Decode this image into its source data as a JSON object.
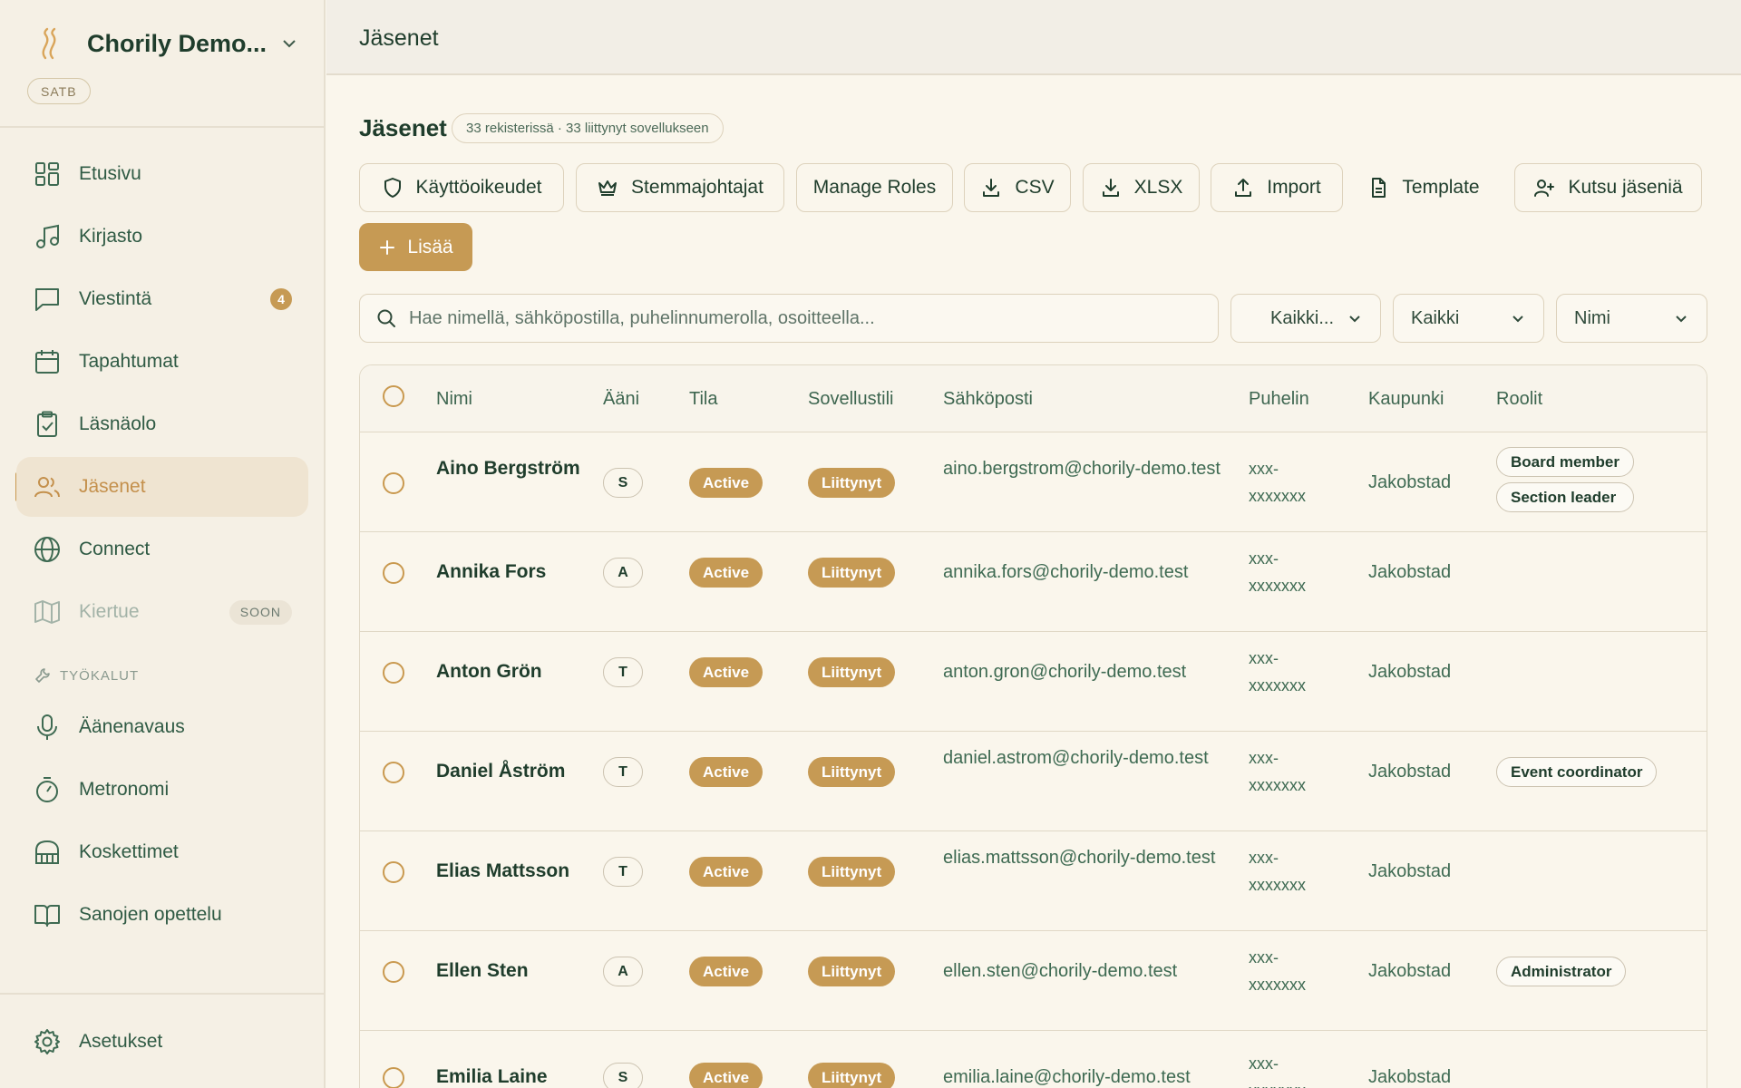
{
  "sidebar": {
    "org_name": "Chorily Demo...",
    "voice_type": "SATB",
    "nav": [
      {
        "label": "Etusivu",
        "icon": "grid-icon"
      },
      {
        "label": "Kirjasto",
        "icon": "music-note-icon"
      },
      {
        "label": "Viestintä",
        "icon": "chat-icon",
        "badge": "4"
      },
      {
        "label": "Tapahtumat",
        "icon": "calendar-icon"
      },
      {
        "label": "Läsnäolo",
        "icon": "clipboard-check-icon"
      },
      {
        "label": "Jäsenet",
        "icon": "users-icon",
        "active": true
      },
      {
        "label": "Connect",
        "icon": "globe-icon"
      },
      {
        "label": "Kiertue",
        "icon": "map-icon",
        "badge": "SOON",
        "disabled": true
      }
    ],
    "tools_label": "TYÖKALUT",
    "tools": [
      {
        "label": "Äänenavaus",
        "icon": "microphone-icon"
      },
      {
        "label": "Metronomi",
        "icon": "timer-icon"
      },
      {
        "label": "Koskettimet",
        "icon": "piano-icon"
      },
      {
        "label": "Sanojen opettelu",
        "icon": "book-open-icon"
      }
    ],
    "settings_label": "Asetukset"
  },
  "topbar": {
    "title": "Jäsenet"
  },
  "main": {
    "title": "Jäsenet",
    "count_summary": "33 rekisterissä · 33 liittynyt sovellukseen",
    "toolbar": {
      "permissions": "Käyttöoikeudet",
      "section_leaders": "Stemmajohtajat",
      "manage_roles": "Manage Roles",
      "csv": "CSV",
      "xlsx": "XLSX",
      "import": "Import",
      "template": "Template",
      "invite": "Kutsu jäseniä",
      "add": "Lisää"
    },
    "search_placeholder": "Hae nimellä, sähköpostilla, puhelinnumerolla, osoitteella...",
    "filters": {
      "voice": "Kaikki...",
      "status": "Kaikki",
      "sort": "Nimi"
    }
  },
  "table": {
    "headers": {
      "name": "Nimi",
      "voice": "Ääni",
      "status": "Tila",
      "app_status": "Sovellustili",
      "email": "Sähköposti",
      "phone": "Puhelin",
      "city": "Kaupunki",
      "roles": "Roolit"
    },
    "rows": [
      {
        "name": "Aino Bergström",
        "voice": "S",
        "status": "Active",
        "app": "Liittynyt",
        "email": "aino.bergstrom@chorily-demo.test",
        "phone": "xxx-xxxxxxx",
        "city": "Jakobstad",
        "roles": [
          "Board member",
          "Section leader"
        ]
      },
      {
        "name": "Annika Fors",
        "voice": "A",
        "status": "Active",
        "app": "Liittynyt",
        "email": "annika.fors@chorily-demo.test",
        "phone": "xxx-xxxxxxx",
        "city": "Jakobstad",
        "roles": []
      },
      {
        "name": "Anton Grön",
        "voice": "T",
        "status": "Active",
        "app": "Liittynyt",
        "email": "anton.gron@chorily-demo.test",
        "phone": "xxx-xxxxxxx",
        "city": "Jakobstad",
        "roles": []
      },
      {
        "name": "Daniel Åström",
        "voice": "T",
        "status": "Active",
        "app": "Liittynyt",
        "email": "daniel.astrom@chorily-demo.test",
        "phone": "xxx-xxxxxxx",
        "city": "Jakobstad",
        "roles": [
          "Event coordinator"
        ]
      },
      {
        "name": "Elias Mattsson",
        "voice": "T",
        "status": "Active",
        "app": "Liittynyt",
        "email": "elias.mattsson@chorily-demo.test",
        "phone": "xxx-xxxxxxx",
        "city": "Jakobstad",
        "roles": []
      },
      {
        "name": "Ellen Sten",
        "voice": "A",
        "status": "Active",
        "app": "Liittynyt",
        "email": "ellen.sten@chorily-demo.test",
        "phone": "xxx-xxxxxxx",
        "city": "Jakobstad",
        "roles": [
          "Administrator"
        ]
      },
      {
        "name": "Emilia Laine",
        "voice": "S",
        "status": "Active",
        "app": "Liittynyt",
        "email": "emilia.laine@chorily-demo.test",
        "phone": "xxx-xxxxxxx",
        "city": "Jakobstad",
        "roles": []
      }
    ]
  },
  "colors": {
    "accent": "#c69a54",
    "text": "#1f3d2c",
    "muted": "#3e6a52",
    "sidebar_bg": "#f5f0e5",
    "page_bg": "#faf6ec"
  }
}
